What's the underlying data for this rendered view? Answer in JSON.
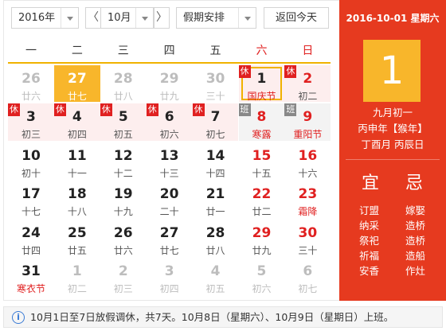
{
  "toolbar": {
    "year": "2016年",
    "month": "10月",
    "prev": "〈",
    "next": "〉",
    "mode": "假期安排",
    "today": "返回今天"
  },
  "weekdays": [
    "一",
    "二",
    "三",
    "四",
    "五",
    "六",
    "日"
  ],
  "weeks": [
    [
      {
        "d": "26",
        "l": "廿六",
        "t": "other"
      },
      {
        "d": "27",
        "l": "廿七",
        "t": "today"
      },
      {
        "d": "28",
        "l": "廿八",
        "t": "other"
      },
      {
        "d": "29",
        "l": "廿九",
        "t": "other"
      },
      {
        "d": "30",
        "l": "三十",
        "t": "other"
      },
      {
        "d": "1",
        "l": "国庆节",
        "t": "holiday selected",
        "badge": "休",
        "lred": true
      },
      {
        "d": "2",
        "l": "初二",
        "t": "holiday weekend",
        "badge": "休"
      }
    ],
    [
      {
        "d": "3",
        "l": "初三",
        "t": "holiday",
        "badge": "休"
      },
      {
        "d": "4",
        "l": "初四",
        "t": "holiday",
        "badge": "休"
      },
      {
        "d": "5",
        "l": "初五",
        "t": "holiday",
        "badge": "休"
      },
      {
        "d": "6",
        "l": "初六",
        "t": "holiday",
        "badge": "休"
      },
      {
        "d": "7",
        "l": "初七",
        "t": "holiday",
        "badge": "休"
      },
      {
        "d": "8",
        "l": "寒露",
        "t": "work weekend",
        "badge": "班",
        "lred": true
      },
      {
        "d": "9",
        "l": "重阳节",
        "t": "work weekend",
        "badge": "班",
        "lred": true
      }
    ],
    [
      {
        "d": "10",
        "l": "初十",
        "t": ""
      },
      {
        "d": "11",
        "l": "十一",
        "t": ""
      },
      {
        "d": "12",
        "l": "十二",
        "t": ""
      },
      {
        "d": "13",
        "l": "十三",
        "t": ""
      },
      {
        "d": "14",
        "l": "十四",
        "t": ""
      },
      {
        "d": "15",
        "l": "十五",
        "t": "weekend"
      },
      {
        "d": "16",
        "l": "十六",
        "t": "weekend"
      }
    ],
    [
      {
        "d": "17",
        "l": "十七",
        "t": ""
      },
      {
        "d": "18",
        "l": "十八",
        "t": ""
      },
      {
        "d": "19",
        "l": "十九",
        "t": ""
      },
      {
        "d": "20",
        "l": "二十",
        "t": ""
      },
      {
        "d": "21",
        "l": "廿一",
        "t": ""
      },
      {
        "d": "22",
        "l": "廿二",
        "t": "weekend"
      },
      {
        "d": "23",
        "l": "霜降",
        "t": "weekend",
        "lred": true
      }
    ],
    [
      {
        "d": "24",
        "l": "廿四",
        "t": ""
      },
      {
        "d": "25",
        "l": "廿五",
        "t": ""
      },
      {
        "d": "26",
        "l": "廿六",
        "t": ""
      },
      {
        "d": "27",
        "l": "廿七",
        "t": ""
      },
      {
        "d": "28",
        "l": "廿八",
        "t": ""
      },
      {
        "d": "29",
        "l": "廿九",
        "t": "weekend"
      },
      {
        "d": "30",
        "l": "三十",
        "t": "weekend"
      }
    ],
    [
      {
        "d": "31",
        "l": "寒衣节",
        "t": "",
        "lred": true
      },
      {
        "d": "1",
        "l": "初二",
        "t": "other"
      },
      {
        "d": "2",
        "l": "初三",
        "t": "other"
      },
      {
        "d": "3",
        "l": "初四",
        "t": "other"
      },
      {
        "d": "4",
        "l": "初五",
        "t": "other"
      },
      {
        "d": "5",
        "l": "初六",
        "t": "other"
      },
      {
        "d": "6",
        "l": "初七",
        "t": "other"
      }
    ]
  ],
  "panel": {
    "date_line": "2016-10-01 星期六",
    "big_day": "1",
    "lunar_date": "九月初一",
    "ganzhi_year": "丙申年【猴年】",
    "ganzhi_month_day": "丁酉月 丙辰日",
    "yi_title": "宜",
    "ji_title": "忌",
    "yi": [
      "订盟",
      "纳采",
      "祭祀",
      "祈福",
      "安香"
    ],
    "ji": [
      "嫁娶",
      "造桥",
      "造桥",
      "造船",
      "作灶"
    ]
  },
  "footer": {
    "icon": "info-icon",
    "message": "10月1日至7日放假调休，共7天。10月8日（星期六）、10月9日（星期日）上班。"
  },
  "colors": {
    "accent_red": "#e63a1f",
    "accent_yellow": "#f8b62b",
    "holiday_bg": "#fdeeee"
  }
}
